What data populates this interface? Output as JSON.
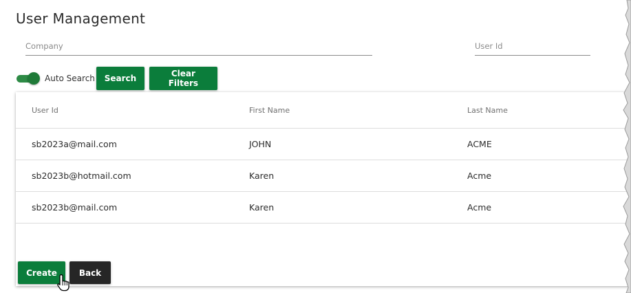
{
  "page": {
    "title": "User Management"
  },
  "filters": {
    "company_placeholder": "Company",
    "company_value": "",
    "user_id_placeholder": "User Id",
    "user_id_value": ""
  },
  "toolbar": {
    "auto_search_label": "Auto Search",
    "auto_search_on": true,
    "search_label": "Search",
    "clear_filters_label": "Clear Filters"
  },
  "grid": {
    "columns": [
      "User Id",
      "First Name",
      "Last Name"
    ],
    "rows": [
      [
        "sb2023a@mail.com",
        "JOHN",
        "ACME"
      ],
      [
        "sb2023b@hotmail.com",
        "Karen",
        "Acme"
      ],
      [
        "sb2023b@mail.com",
        "Karen",
        "Acme"
      ]
    ]
  },
  "actions": {
    "create_label": "Create",
    "back_label": "Back"
  },
  "colors": {
    "primary_green": "#0b7d3b",
    "dark_button": "#262626",
    "toggle_on": "#2e8b46"
  },
  "icons": {
    "cursor": "hand-pointer-icon"
  }
}
